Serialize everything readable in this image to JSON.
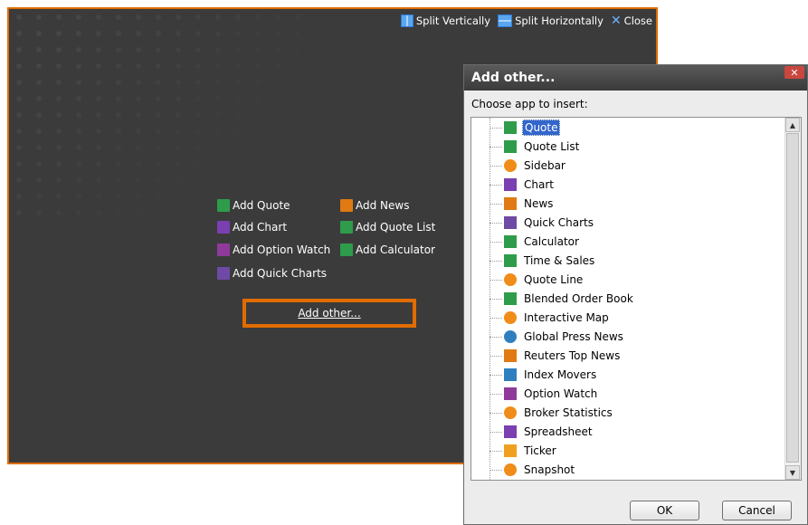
{
  "toolbar": {
    "split_vertically": "Split Vertically",
    "split_horizontally": "Split Horizontally",
    "close": "Close"
  },
  "add_links": {
    "add_quote": "Add Quote",
    "add_news": "Add News",
    "add_chart": "Add Chart",
    "add_quote_list": "Add Quote List",
    "add_option_watch": "Add Option Watch",
    "add_calculator": "Add Calculator",
    "add_quick_charts": "Add Quick Charts",
    "add_other": "Add other..."
  },
  "dialog": {
    "title": "Add other...",
    "close_glyph": "✕",
    "prompt": "Choose app to insert:",
    "items": [
      {
        "label": "Quote",
        "icon": "quote-icon",
        "selected": true
      },
      {
        "label": "Quote List",
        "icon": "quote-list-icon"
      },
      {
        "label": "Sidebar",
        "icon": "sidebar-icon"
      },
      {
        "label": "Chart",
        "icon": "chart-icon"
      },
      {
        "label": "News",
        "icon": "news-icon"
      },
      {
        "label": "Quick Charts",
        "icon": "quick-charts-icon"
      },
      {
        "label": "Calculator",
        "icon": "calculator-icon"
      },
      {
        "label": "Time & Sales",
        "icon": "time-sales-icon"
      },
      {
        "label": "Quote Line",
        "icon": "quote-line-icon"
      },
      {
        "label": "Blended Order Book",
        "icon": "order-book-icon"
      },
      {
        "label": "Interactive Map",
        "icon": "interactive-map-icon"
      },
      {
        "label": "Global Press News",
        "icon": "globe-icon"
      },
      {
        "label": "Reuters Top News",
        "icon": "reuters-news-icon"
      },
      {
        "label": "Index Movers",
        "icon": "index-movers-icon"
      },
      {
        "label": "Option Watch",
        "icon": "option-watch-icon"
      },
      {
        "label": "Broker Statistics",
        "icon": "broker-statistics-icon"
      },
      {
        "label": "Spreadsheet",
        "icon": "spreadsheet-icon"
      },
      {
        "label": "Ticker",
        "icon": "ticker-icon"
      },
      {
        "label": "Snapshot",
        "icon": "snapshot-icon"
      }
    ],
    "ok": "OK",
    "cancel": "Cancel"
  },
  "colors": {
    "accent_orange": "#e06c00",
    "panel_bg": "#3b3b3b",
    "selection_blue": "#3366cc"
  }
}
